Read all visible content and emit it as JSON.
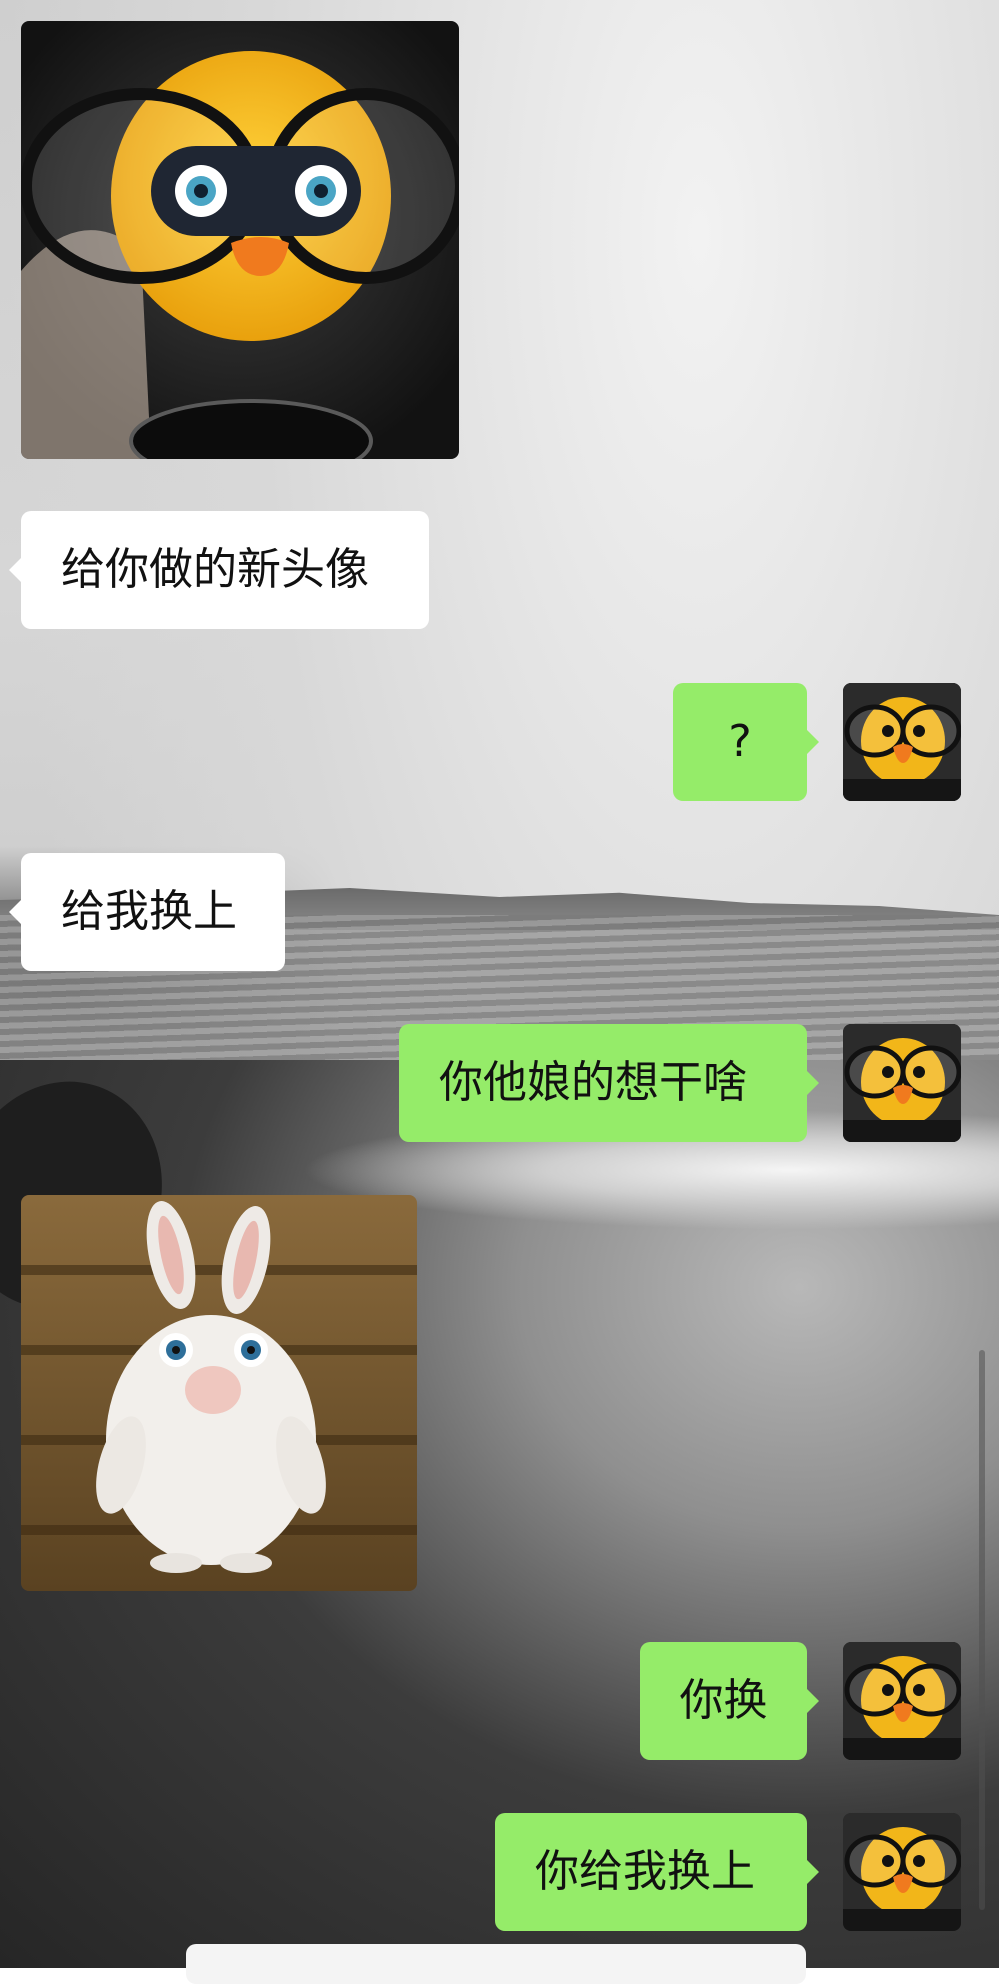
{
  "messages": [
    {
      "side": "in",
      "kind": "image",
      "image": "duck-glasses-sticker"
    },
    {
      "side": "in",
      "kind": "text",
      "text": "给你做的新头像"
    },
    {
      "side": "out",
      "kind": "text",
      "text": "?"
    },
    {
      "side": "in",
      "kind": "text",
      "text": "给我换上"
    },
    {
      "side": "out",
      "kind": "text",
      "text": "你他娘的想干啥"
    },
    {
      "side": "in",
      "kind": "image",
      "image": "white-rabbit-sticker"
    },
    {
      "side": "out",
      "kind": "text",
      "text": "你换"
    },
    {
      "side": "out",
      "kind": "text",
      "text": "你给我换上"
    }
  ],
  "colors": {
    "incoming_bubble": "#ffffff",
    "outgoing_bubble": "#95ec69"
  },
  "avatar": {
    "icon": "duck-with-glasses-avatar"
  }
}
